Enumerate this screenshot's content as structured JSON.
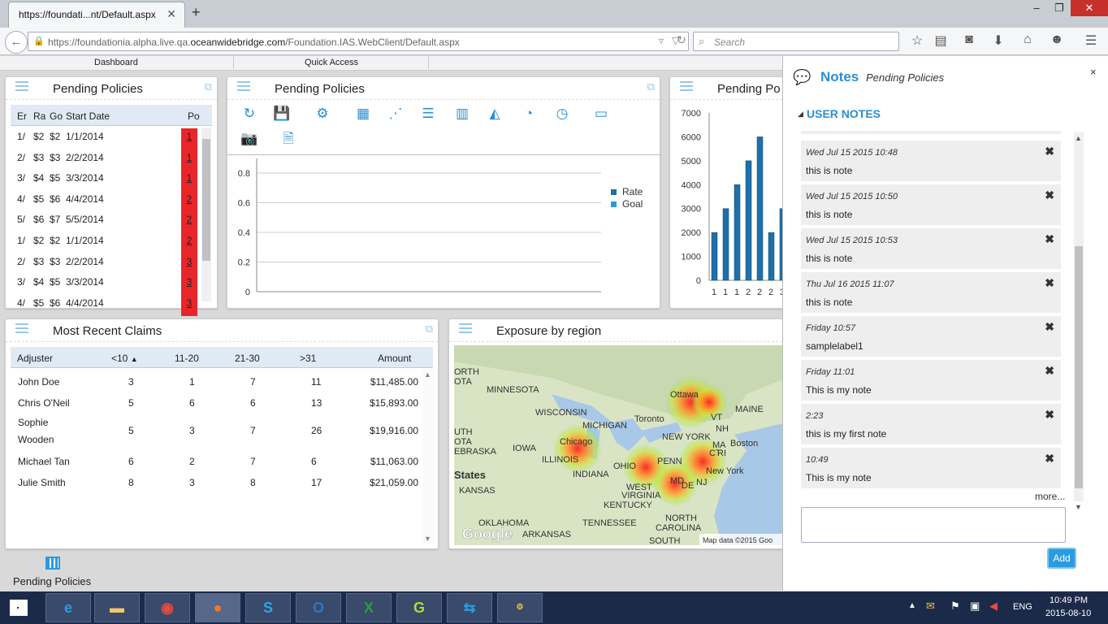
{
  "browser": {
    "tab_title": "https://foundati...nt/Default.aspx",
    "url_prefix": "https://foundationia.alpha.live.qa.",
    "url_domain": "oceanwidebridge.com",
    "url_path": "/Foundation.IAS.WebClient/Default.aspx",
    "search_placeholder": "Search"
  },
  "menu": {
    "dashboard": "Dashboard",
    "quick_access": "Quick Access"
  },
  "pending1": {
    "title": "Pending Policies",
    "headers": [
      "Er",
      "Ra",
      "Go",
      "Start Date",
      "Po"
    ],
    "rows": [
      [
        "1/",
        "$2",
        "$2",
        "1/1/2014",
        "1"
      ],
      [
        "2/",
        "$3",
        "$3",
        "2/2/2014",
        "1"
      ],
      [
        "3/",
        "$4",
        "$5",
        "3/3/2014",
        "1"
      ],
      [
        "4/",
        "$5",
        "$6",
        "4/4/2014",
        "2"
      ],
      [
        "5/",
        "$6",
        "$7",
        "5/5/2014",
        "2"
      ],
      [
        "1/",
        "$2",
        "$2",
        "1/1/2014",
        "2"
      ],
      [
        "2/",
        "$3",
        "$3",
        "2/2/2014",
        "3"
      ],
      [
        "3/",
        "$4",
        "$5",
        "3/3/2014",
        "3"
      ],
      [
        "4/",
        "$5",
        "$6",
        "4/4/2014",
        "3"
      ]
    ]
  },
  "pending2": {
    "title": "Pending Policies"
  },
  "pending3": {
    "title": "Pending Po"
  },
  "chart_data": [
    {
      "type": "line",
      "title": "",
      "xlabel": "",
      "ylabel": "",
      "yticks": [
        "0.8",
        "0.6",
        "0.4",
        "0.2",
        "0"
      ],
      "ylim": [
        0,
        0.8
      ],
      "series": [
        {
          "name": "Rate",
          "color": "#1f6fa8",
          "values": []
        },
        {
          "name": "Goal",
          "color": "#2a9be0",
          "values": []
        }
      ],
      "legend": "right"
    },
    {
      "type": "bar",
      "title": "",
      "yticks": [
        "7000",
        "6000",
        "5000",
        "4000",
        "3000",
        "2000",
        "1000",
        "0"
      ],
      "ylim": [
        0,
        7000
      ],
      "categories": [
        "1",
        "1",
        "1",
        "2",
        "2",
        "2",
        "3"
      ],
      "values": [
        2000,
        3000,
        4000,
        5000,
        6000,
        2000,
        3000
      ]
    }
  ],
  "claims": {
    "title": "Most Recent Claims",
    "headers": [
      "Adjuster",
      "<10",
      "11-20",
      "21-30",
      ">31",
      "Amount"
    ],
    "rows": [
      [
        "John Doe",
        "",
        "3",
        "1",
        "7",
        "11",
        "$11,485.00"
      ],
      [
        "Chris O'Neil",
        "",
        "5",
        "6",
        "6",
        "13",
        "$15,893.00"
      ],
      [
        "Sophie",
        "Wooden",
        "5",
        "3",
        "7",
        "26",
        "$19,916.00"
      ],
      [
        "Michael Tan",
        "",
        "6",
        "2",
        "7",
        "6",
        "$11,063.00"
      ],
      [
        "Julie Smith",
        "",
        "8",
        "3",
        "8",
        "17",
        "$21,059.00"
      ]
    ]
  },
  "exposure": {
    "title": "Exposure by region",
    "credit": "Map data ©2015 Goo",
    "google": "Google",
    "labels": [
      "ORTH",
      "OTA",
      "MINNESOTA",
      "WISCONSIN",
      "MICHIGAN",
      "Ottawa",
      "MAINE",
      "VT",
      "NH",
      "Toronto",
      "NEW YORK",
      "MA",
      "Boston",
      "CT",
      "RI",
      "New York",
      "NJ",
      "Chicago",
      "IOWA",
      "ILLINOIS",
      "INDIANA",
      "OHIO",
      "PENN",
      "MD",
      "DE",
      "WEST",
      "VIRGINIA",
      "KENTUCKY",
      "TENNESSEE",
      "NORTH",
      "CAROLINA",
      "SOUTH",
      "OKLAHOMA",
      "ARKANSAS",
      "KANSAS",
      "EBRASKA",
      "States",
      "UTH",
      "OTA"
    ]
  },
  "notes": {
    "title": "Notes",
    "subtitle": "Pending Policies",
    "section": "USER NOTES",
    "more": "more...",
    "add": "Add",
    "items": [
      {
        "date": "Wed Jul 15 2015 10:48",
        "text": "this is note"
      },
      {
        "date": "Wed Jul 15 2015 10:50",
        "text": "this is note"
      },
      {
        "date": "Wed Jul 15 2015 10:53",
        "text": "this is note"
      },
      {
        "date": "Thu Jul 16 2015 11:07",
        "text": "this is note"
      },
      {
        "date": "Friday 10:57",
        "text": "samplelabel1"
      },
      {
        "date": "Friday 11:01",
        "text": "This is my note"
      },
      {
        "date": "2:23",
        "text": "this is my first note"
      },
      {
        "date": "10:49",
        "text": "This is my note"
      }
    ]
  },
  "dock": {
    "label": "Pending Policies"
  },
  "taskbar": {
    "lang": "ENG",
    "time": "10:49 PM",
    "date": "2015-08-10"
  }
}
